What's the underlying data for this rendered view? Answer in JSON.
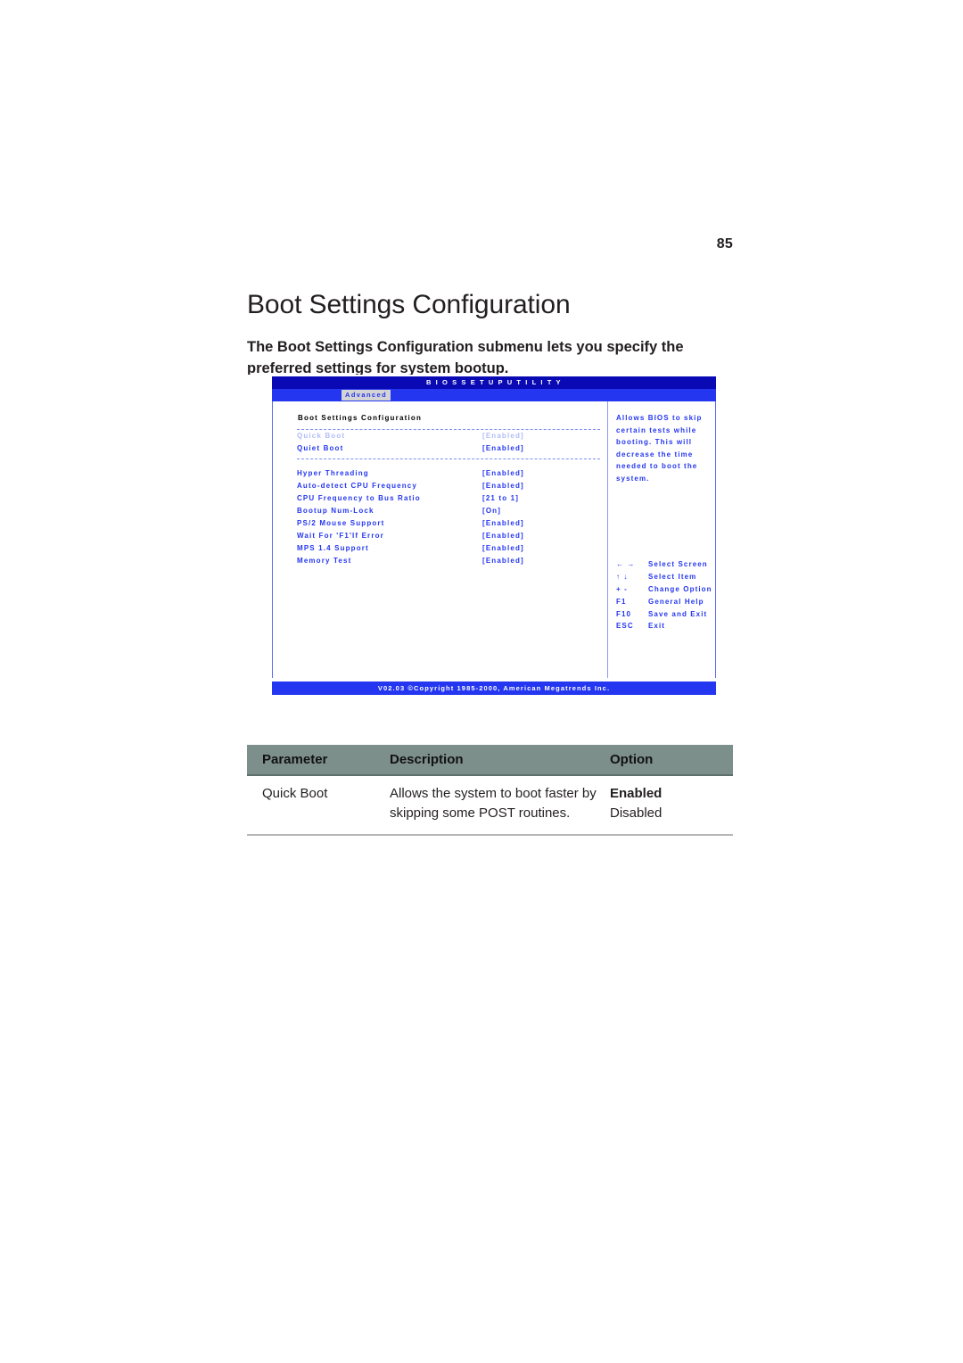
{
  "page": {
    "number": "85",
    "title": "Boot Settings Configuration",
    "intro": "The Boot Settings Configuration submenu lets you specify the preferred settings for system bootup."
  },
  "bios": {
    "title_bar": "B I O S   S E T U P   U T I L I T Y",
    "active_tab": "Advanced",
    "section_title": "Boot Settings Configuration",
    "group_a": [
      {
        "label": "Quick Boot",
        "value": "[Enabled]",
        "selected": true
      },
      {
        "label": "Quiet Boot",
        "value": "[Enabled]",
        "selected": false
      }
    ],
    "group_b": [
      {
        "label": "Hyper Threading",
        "value": "[Enabled]"
      },
      {
        "label": "Auto-detect CPU Frequency",
        "value": "[Enabled]"
      },
      {
        "label": "CPU Frequency to Bus Ratio",
        "value": "[21 to 1]"
      },
      {
        "label": "Bootup Num-Lock",
        "value": "[On]"
      },
      {
        "label": "PS/2 Mouse Support",
        "value": "[Enabled]"
      },
      {
        "label": "Wait For 'F1'If Error",
        "value": "[Enabled]"
      },
      {
        "label": "MPS 1.4 Support",
        "value": "[Enabled]"
      },
      {
        "label": "Memory Test",
        "value": "[Enabled]"
      }
    ],
    "help_lines": [
      "Allows BIOS to skip",
      "certain tests while",
      "booting. This will",
      "decrease the time",
      "needed to boot the",
      "system."
    ],
    "legend": [
      {
        "keys": "← →",
        "desc": "Select Screen"
      },
      {
        "keys": "↑ ↓",
        "desc": "Select Item"
      },
      {
        "keys": "+ -",
        "desc": "Change Option"
      },
      {
        "keys": "F1",
        "desc": "General Help"
      },
      {
        "keys": "F10",
        "desc": "Save and Exit"
      },
      {
        "keys": "ESC",
        "desc": "Exit"
      }
    ],
    "footer": "V02.03 ©Copyright 1985-2000, American Megatrends Inc.",
    "colors": {
      "title_bar_bg": "#0a0ab4",
      "tab_bar_bg": "#2436f0",
      "text_blue": "#2436f0",
      "dim_blue": "#b3bdf9",
      "tab_active_bg": "#d4d4d4"
    }
  },
  "table": {
    "headers": [
      "Parameter",
      "Description",
      "Option"
    ],
    "rows": [
      {
        "parameter": "Quick Boot",
        "description": "Allows the system to boot faster by skipping some POST routines.",
        "option_selected": "Enabled",
        "option_other": "Disabled"
      }
    ],
    "colors": {
      "header_bg": "#7d8f8a",
      "rule": "#b7b7b7"
    }
  }
}
